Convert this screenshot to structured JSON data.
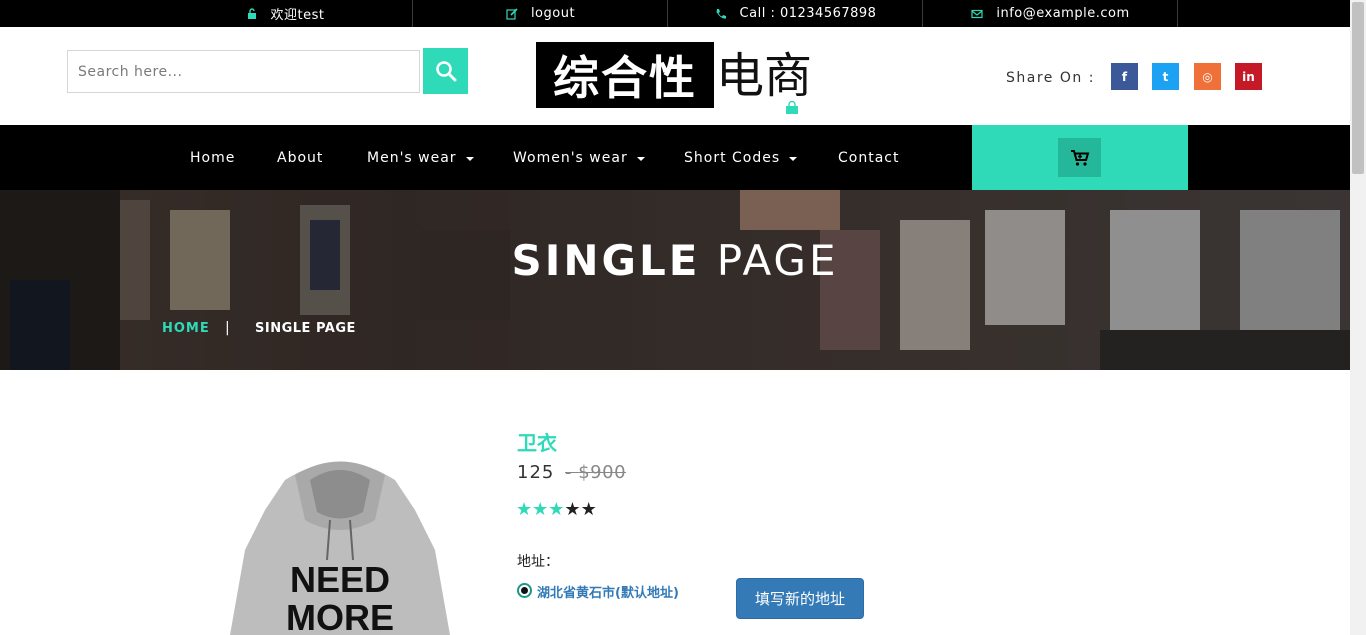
{
  "topbar": {
    "welcome": "欢迎test",
    "logout": "logout",
    "call": "Call : 01234567898",
    "email": "info@example.com"
  },
  "search": {
    "placeholder": "Search here..."
  },
  "logo": {
    "part1": "综合性",
    "part2": "电商"
  },
  "share": {
    "label": "Share On :",
    "networks": [
      {
        "icon": "facebook-icon",
        "glyph": "f",
        "color": "#3b5998"
      },
      {
        "icon": "twitter-icon",
        "glyph": "t",
        "color": "#1da1f2"
      },
      {
        "icon": "instagram-icon",
        "glyph": "◎",
        "color": "#f0703a"
      },
      {
        "icon": "linkedin-icon",
        "glyph": "in",
        "color": "#c41a28"
      }
    ]
  },
  "nav": {
    "items": [
      "Home",
      "About",
      "Men's wear",
      "Women's wear",
      "Short Codes",
      "Contact"
    ]
  },
  "banner": {
    "title_bold": "SINGLE",
    "title_light": "PAGE",
    "crumb_home": "HOME",
    "crumb_sep": "|",
    "crumb_current": "SINGLE PAGE"
  },
  "product": {
    "title": "卫衣",
    "price": "125",
    "old_price": "$900",
    "rating": 3,
    "rating_max": 5,
    "address_label": "地址：",
    "address_default": "湖北省黄石市(默认地址)",
    "new_address_button": "填写新的地址",
    "image_text_line1": "NEED",
    "image_text_line2": "MORE"
  },
  "colors": {
    "accent": "#2fdab8",
    "primary_button": "#337ab7"
  }
}
